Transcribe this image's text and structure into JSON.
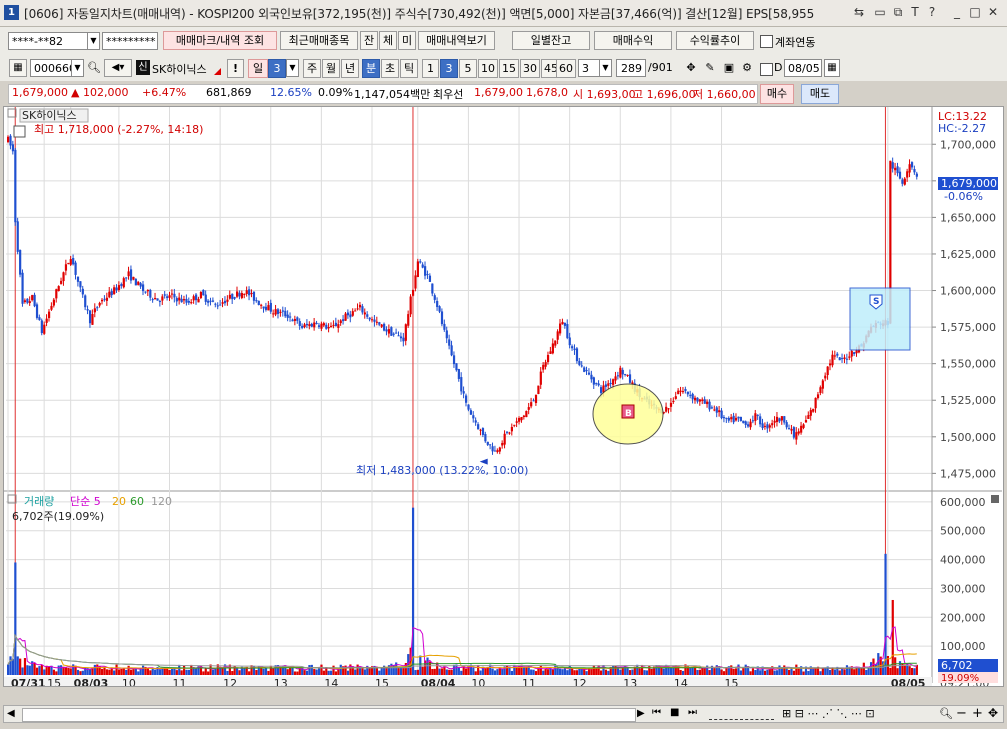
{
  "window": {
    "num": "1",
    "title": "[0606] 자동일지차트(매매내역) - KOSPI200 외국인보유[372,195(천)] 주식수[730,492(천)] 액면[5,000] 자본금[37,466(억)] 결산[12월] EPS[58,955",
    "buttons": [
      "⇆",
      "▭",
      "⧉",
      "¶",
      "T",
      "?",
      "_",
      "□",
      "✕"
    ]
  },
  "toolbar1": {
    "account": "****-**82",
    "password": "*********",
    "b_mark": "매매마크/내역 조회",
    "b_recent": "최근매매종목",
    "b_jan": "잔",
    "b_che": "체",
    "b_mi": "미",
    "b_history": "매매내역보기",
    "b_daily": "일별잔고",
    "b_profit": "매매수익",
    "b_return": "수익률추이",
    "acct_link": "계좌연동"
  },
  "toolbar2": {
    "code": "000660",
    "badge": "신",
    "name": "SK하이닉스",
    "day": "일",
    "day_num": "3",
    "periods": [
      "주",
      "월",
      "년",
      "분",
      "초",
      "틱"
    ],
    "active_period": "분",
    "intervals": [
      "1",
      "3",
      "5",
      "10",
      "15",
      "30",
      "45",
      "60"
    ],
    "active_interval": "3",
    "sel_num": "3",
    "count": "289",
    "count_total": "/901",
    "date_label": "D",
    "date": "08/05"
  },
  "quote": {
    "price": "1,679,000",
    "change": "▲ 102,000",
    "rate": "+6.47%",
    "volume": "681,869",
    "vol_rate": "12.65%",
    "turnover": "0.09%",
    "amount": "1,147,054백만",
    "best": "최우선",
    "bid": "1,679,00",
    "ask": "1,678,0",
    "open": "시 1,693,00",
    "high": "고 1,696,00",
    "low": "저 1,660,00",
    "buy": "매수",
    "sell": "매도"
  },
  "chart_data": [
    {
      "type": "candlestick",
      "title": "SK하이닉스",
      "annotation_high": "최고 1,718,000 (-2.27%, 14:18)",
      "annotation_low": "최저 1,483,000 (13.22%, 10:00)",
      "lc": "LC:13.22",
      "hc": "HC:-2.27",
      "current_price_label": "1,679,000",
      "current_change_label": "-0.06%",
      "ylim": [
        1465000,
        1720000
      ],
      "y_ticks": [
        "1,700,000",
        "1,675,000",
        "1,650,000",
        "1,625,000",
        "1,600,000",
        "1,575,000",
        "1,550,000",
        "1,525,000",
        "1,500,000",
        "1,475,000"
      ],
      "x_labels": [
        "07/31",
        "15",
        "08/03",
        "10",
        "11",
        "12",
        "13",
        "14",
        "15",
        "08/04",
        "10",
        "11",
        "12",
        "13",
        "14",
        "15",
        "08/05"
      ],
      "markers": [
        {
          "label": "B",
          "type": "buy"
        },
        {
          "label": "S",
          "type": "sell"
        }
      ],
      "close_path": [
        [
          0,
          1703000
        ],
        [
          2,
          1695000
        ],
        [
          3,
          1648000
        ],
        [
          6,
          1590000
        ],
        [
          10,
          1595000
        ],
        [
          14,
          1572000
        ],
        [
          18,
          1590000
        ],
        [
          22,
          1608000
        ],
        [
          26,
          1624000
        ],
        [
          30,
          1600000
        ],
        [
          34,
          1580000
        ],
        [
          38,
          1592000
        ],
        [
          44,
          1600000
        ],
        [
          50,
          1611000
        ],
        [
          56,
          1600000
        ],
        [
          62,
          1594000
        ],
        [
          68,
          1596000
        ],
        [
          74,
          1592000
        ],
        [
          80,
          1597000
        ],
        [
          86,
          1590000
        ],
        [
          92,
          1595000
        ],
        [
          98,
          1600000
        ],
        [
          104,
          1592000
        ],
        [
          110,
          1586000
        ],
        [
          116,
          1583000
        ],
        [
          122,
          1575000
        ],
        [
          128,
          1578000
        ],
        [
          134,
          1574000
        ],
        [
          140,
          1582000
        ],
        [
          146,
          1588000
        ],
        [
          152,
          1578000
        ],
        [
          158,
          1572000
        ],
        [
          164,
          1567000
        ],
        [
          170,
          1620000
        ],
        [
          174,
          1610000
        ],
        [
          178,
          1590000
        ],
        [
          182,
          1565000
        ],
        [
          186,
          1545000
        ],
        [
          190,
          1522000
        ],
        [
          194,
          1510000
        ],
        [
          198,
          1498000
        ],
        [
          202,
          1490000
        ],
        [
          206,
          1500000
        ],
        [
          210,
          1508000
        ],
        [
          214,
          1515000
        ],
        [
          218,
          1525000
        ],
        [
          222,
          1548000
        ],
        [
          226,
          1563000
        ],
        [
          230,
          1580000
        ],
        [
          234,
          1560000
        ],
        [
          238,
          1548000
        ],
        [
          242,
          1540000
        ],
        [
          246,
          1532000
        ],
        [
          250,
          1538000
        ],
        [
          254,
          1546000
        ],
        [
          258,
          1538000
        ],
        [
          262,
          1528000
        ],
        [
          266,
          1522000
        ],
        [
          270,
          1518000
        ],
        [
          274,
          1520000
        ],
        [
          278,
          1532000
        ],
        [
          282,
          1530000
        ],
        [
          286,
          1525000
        ],
        [
          290,
          1522000
        ],
        [
          294,
          1518000
        ],
        [
          298,
          1510000
        ],
        [
          302,
          1512000
        ],
        [
          306,
          1508000
        ],
        [
          310,
          1514000
        ],
        [
          314,
          1506000
        ],
        [
          318,
          1512000
        ],
        [
          322,
          1512000
        ],
        [
          326,
          1500000
        ],
        [
          330,
          1508000
        ],
        [
          334,
          1520000
        ],
        [
          338,
          1540000
        ],
        [
          342,
          1555000
        ],
        [
          346,
          1552000
        ],
        [
          350,
          1558000
        ],
        [
          354,
          1562000
        ],
        [
          358,
          1575000
        ],
        [
          362,
          1578000
        ],
        [
          365,
          1690000
        ],
        [
          368,
          1682000
        ],
        [
          371,
          1674000
        ],
        [
          374,
          1688000
        ],
        [
          377,
          1679000
        ]
      ],
      "volume": {
        "legend": [
          "거래량",
          "단순 5",
          "20",
          "60",
          "120"
        ],
        "current": "6,702주(19.09%)",
        "ylim": [
          0,
          610000
        ],
        "y_ticks": [
          "600,000",
          "500,000",
          "400,000",
          "300,000",
          "200,000",
          "100,000"
        ],
        "current_label": "6,702",
        "current_rate": "19.09%",
        "spikes": [
          [
            3,
            390000
          ],
          [
            168,
            580000
          ],
          [
            364,
            420000
          ],
          [
            367,
            260000
          ]
        ]
      },
      "time_label": "09:21:00"
    }
  ],
  "colors": {
    "up": "#e00000",
    "down": "#1f4fd0",
    "accent": "#3d6fc4",
    "grid": "#dcdcdc"
  }
}
